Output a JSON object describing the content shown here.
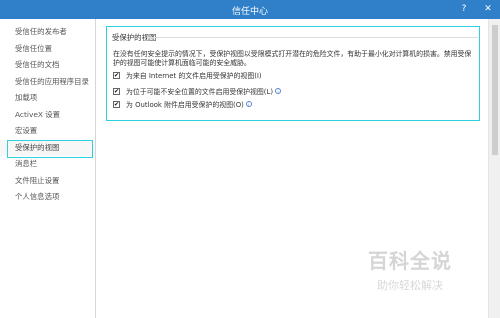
{
  "window": {
    "title": "信任中心",
    "help_glyph": "?",
    "close_glyph": "✕"
  },
  "sidebar": {
    "items": [
      {
        "label": "受信任的发布者"
      },
      {
        "label": "受信任位置"
      },
      {
        "label": "受信任的文档"
      },
      {
        "label": "受信任的应用程序目录"
      },
      {
        "label": "加载项"
      },
      {
        "label": "ActiveX 设置"
      },
      {
        "label": "宏设置"
      },
      {
        "label": "受保护的视图"
      },
      {
        "label": "消息栏"
      },
      {
        "label": "文件阻止设置"
      },
      {
        "label": "个人信息选项"
      }
    ],
    "active_index": 7
  },
  "main": {
    "section_title": "受保护的视图",
    "description": "在没有任何安全提示的情况下，受保护视图以受限模式打开潜在的危险文件，有助于最小化对计算机的损害。禁用受保护的视图可能使计算机面临可能的安全威胁。",
    "options": [
      {
        "label": "为来自 Internet 的文件启用受保护的视图(I)",
        "checked": true,
        "info": false
      },
      {
        "label": "为位于可能不安全位置的文件启用受保护视图(L)",
        "checked": true,
        "info": true
      },
      {
        "label": "为 Outlook 附件启用受保护的视图(O)",
        "checked": true,
        "info": true
      }
    ],
    "check_glyph": "✔",
    "info_glyph": "i"
  },
  "watermark": {
    "main": "百科全说",
    "sub": "助你轻松解决"
  },
  "colors": {
    "titlebar": "#2f7fc9",
    "highlight": "#2fd1de"
  }
}
